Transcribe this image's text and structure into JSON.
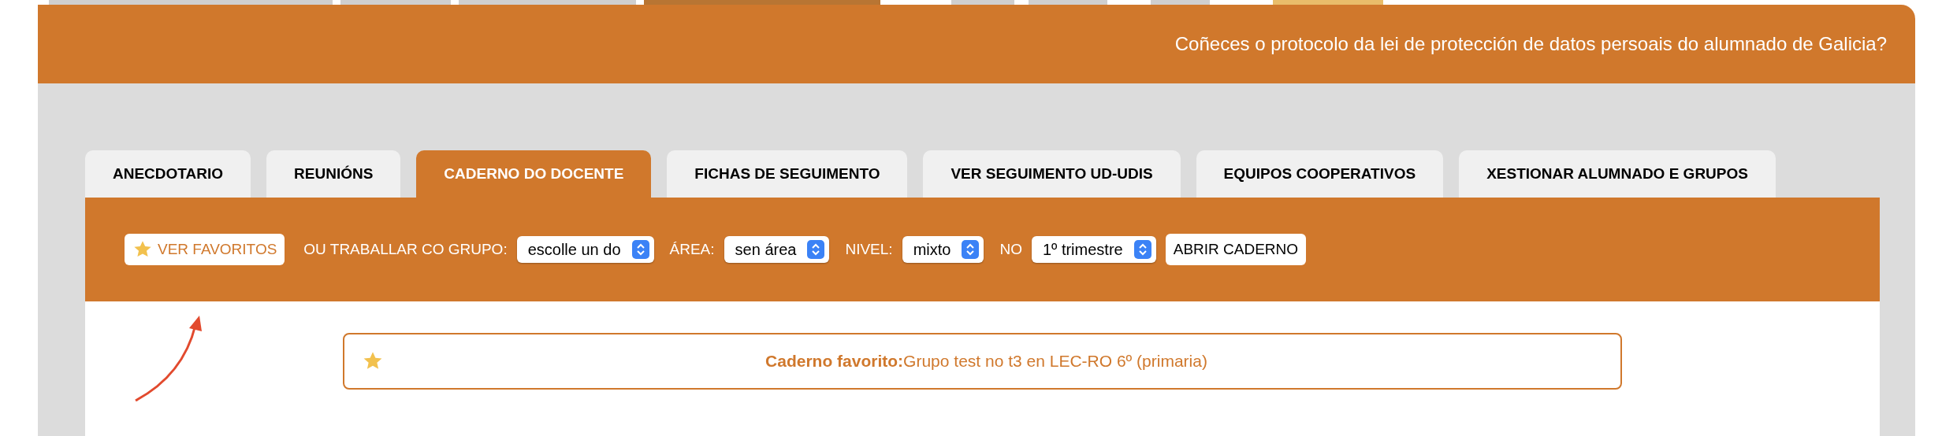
{
  "header": {
    "text": "Coñeces o protocolo da lei de protección de datos persoais do alumnado de Galicia?"
  },
  "tabs": [
    {
      "label": "ANECDOTARIO",
      "selected": false
    },
    {
      "label": "REUNIÓNS",
      "selected": false
    },
    {
      "label": "CADERNO DO DOCENTE",
      "selected": true
    },
    {
      "label": "FICHAS DE SEGUIMENTO",
      "selected": false
    },
    {
      "label": "VER SEGUIMENTO UD-UDIS",
      "selected": false
    },
    {
      "label": "EQUIPOS COOPERATIVOS",
      "selected": false
    },
    {
      "label": "XESTIONAR ALUMNADO E GRUPOS",
      "selected": false
    }
  ],
  "toolbar": [
    {
      "kind": "button",
      "label": "VER FAVORITOS",
      "star": true
    },
    {
      "kind": "select",
      "label": "OU TRABALLAR CO GRUPO:",
      "value": "escolle un do"
    },
    {
      "kind": "select",
      "label": "ÁREA:",
      "value": "sen área"
    },
    {
      "kind": "select",
      "label": "NIVEL:",
      "value": "mixto"
    },
    {
      "kind": "select",
      "label": "NO",
      "value": "1º trimestre"
    },
    {
      "kind": "button",
      "label": "ABRIR CADERNO",
      "star": false
    }
  ],
  "favorite": {
    "label": "Caderno favorito:",
    "text": "Grupo test no t3 en LEC-RO 6º (primaria)"
  }
}
